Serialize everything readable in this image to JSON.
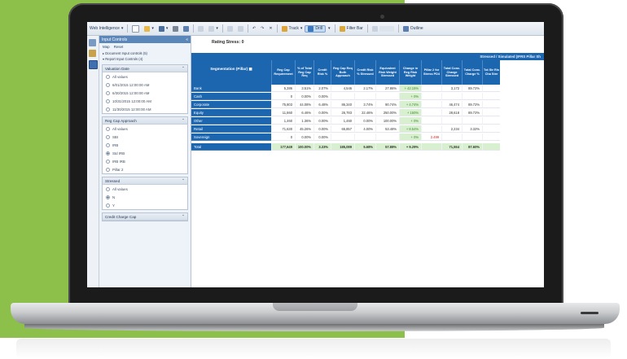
{
  "toolbar": {
    "app_menu": "Web Intelligence",
    "track": "Track",
    "drill": "Drill",
    "filter_bar": "Filter Bar",
    "outline": "Outline"
  },
  "panel": {
    "title": "Input Controls",
    "links": [
      "Map",
      "Reset"
    ],
    "doc_controls": "Document Input controls (5)",
    "report_controls": "Report Input Controls (4)",
    "groups": [
      {
        "title": "Valuation Date",
        "options": [
          {
            "label": "All values",
            "selected": false
          },
          {
            "label": "6/01/2015 12:00:00 AM",
            "selected": false
          },
          {
            "label": "6/30/2015 12:00:00 AM",
            "selected": false
          },
          {
            "label": "10/31/2015 12:00:00 AM",
            "selected": false
          },
          {
            "label": "11/30/2015 12:00:00 AM",
            "selected": false
          }
        ]
      },
      {
        "title": "Reg Cap Approach",
        "options": [
          {
            "label": "All values",
            "selected": false
          },
          {
            "label": "SBI",
            "selected": false
          },
          {
            "label": "IRB",
            "selected": false
          },
          {
            "label": "Std IRB",
            "selected": true
          },
          {
            "label": "IRB IRB",
            "selected": false
          },
          {
            "label": "Pillar 2",
            "selected": false
          }
        ]
      },
      {
        "title": "Stressed",
        "options": [
          {
            "label": "All values",
            "selected": false
          },
          {
            "label": "N",
            "selected": true
          },
          {
            "label": "Y",
            "selected": false
          }
        ]
      },
      {
        "title": "Credit Charge Cap",
        "options": []
      }
    ]
  },
  "report": {
    "title": "Rating Stress: 0",
    "band_label": "Stressed / Simulated (IFRS Pillar Sh",
    "segment_header": "Segmentation (Pillar)",
    "columns": [
      "Reg Cap Requirement",
      "% of Total Reg Cap Req",
      "Credit Risk %",
      "Reg Cap Req Both Approach",
      "Credit Risk % Stressed",
      "Equivalent Risk Weight Stressed",
      "Change in Reg Risk Weight",
      "Pillar 2 for Stress PD4",
      "Total Conc. Charge Stressed",
      "Total Conc. Charge %",
      "Tot Str Ris Cha Stre"
    ],
    "rows": [
      {
        "label": "Bank",
        "values": [
          "5,386",
          "3.51%",
          "2.07%",
          "4,546",
          "2.17%",
          "27.86%",
          "+ 42.15%",
          "",
          "3,172",
          "89.72%",
          ""
        ]
      },
      {
        "label": "Cash",
        "values": [
          "0",
          "0.00%",
          "0.00%",
          "",
          "",
          "",
          "+ 0%",
          "",
          "",
          "",
          ""
        ]
      },
      {
        "label": "Corporate",
        "values": [
          "75,803",
          "44.08%",
          "6.48%",
          "86,340",
          "3.74%",
          "90.74%",
          "+ 4.74%",
          "",
          "46,474",
          "89.72%",
          ""
        ]
      },
      {
        "label": "Equity",
        "values": [
          "11,860",
          "6.46%",
          "0.00%",
          "26,783",
          "22.46%",
          "250.00%",
          "+ 150%",
          "",
          "28,618",
          "89.72%",
          ""
        ]
      },
      {
        "label": "Other",
        "values": [
          "1,460",
          "1.36%",
          "0.00%",
          "1,460",
          "0.00%",
          "100.00%",
          "+ 0%",
          "",
          "",
          "",
          ""
        ]
      },
      {
        "label": "Retail",
        "values": [
          "71,630",
          "45.26%",
          "0.00%",
          "65,857",
          "4.00%",
          "53.48%",
          "+ 8.54%",
          "",
          "2,234",
          "3.32%",
          ""
        ]
      },
      {
        "label": "Sovereign",
        "values": [
          "0",
          "0.00%",
          "0.00%",
          "",
          "",
          "",
          "+ 0%",
          "2.499",
          "",
          "",
          ""
        ]
      }
    ],
    "total": {
      "label": "Total",
      "values": [
        "177,649",
        "100.00%",
        "3.33%",
        "185,089",
        "5.68%",
        "57.88%",
        "+ 9.29%",
        "",
        "71,554",
        "87.60%",
        ""
      ]
    }
  }
}
